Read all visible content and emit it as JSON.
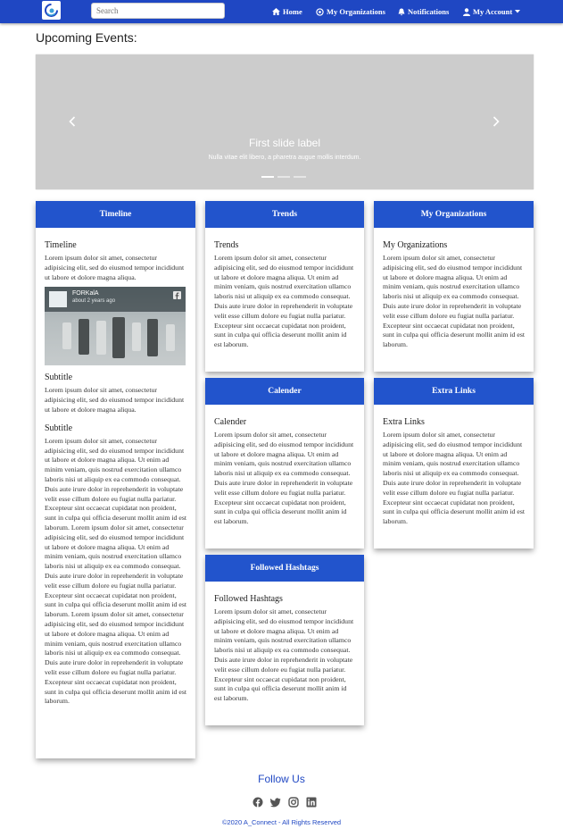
{
  "nav": {
    "search_placeholder": "Search",
    "home": "Home",
    "organizations": "My Organizations",
    "notifications": "Notifications",
    "account": "My Account"
  },
  "events": {
    "title": "Upcoming Events:",
    "slide_label": "First slide label",
    "slide_text": "Nulla vitae elit libero, a pharetra augue mollis interdum."
  },
  "video": {
    "channel": "FORKalA",
    "time": "about 2 years ago"
  },
  "timeline": {
    "header": "Timeline",
    "title": "Timeline",
    "text": "Lorem ipsum dolor sit amet, consectetur adipisicing elit, sed do eiusmod tempor incididunt ut labore et dolore magna aliqua.",
    "subtitle1": "Subtitle",
    "text2": "Lorem ipsum dolor sit amet, consectetur adipisicing elit, sed do eiusmod tempor incididunt ut labore et dolore magna aliqua.",
    "subtitle2": "Subtitle",
    "long_text": "Lorem ipsum dolor sit amet, consectetur adipisicing elit, sed do eiusmod tempor incididunt ut labore et dolore magna aliqua. Ut enim ad minim veniam, quis nostrud exercitation ullamco laboris nisi ut aliquip ex ea commodo consequat. Duis aute irure dolor in reprehenderit in voluptate velit esse cillum dolore eu fugiat nulla pariatur. Excepteur sint occaecat cupidatat non proident, sunt in culpa qui officia deserunt mollit anim id est laborum. Lorem ipsum dolor sit amet, consectetur adipisicing elit, sed do eiusmod tempor incididunt ut labore et dolore magna aliqua. Ut enim ad minim veniam, quis nostrud exercitation ullamco laboris nisi ut aliquip ex ea commodo consequat. Duis aute irure dolor in reprehenderit in voluptate velit esse cillum dolore eu fugiat nulla pariatur. Excepteur sint occaecat cupidatat non proident, sunt in culpa qui officia deserunt mollit anim id est laborum. Lorem ipsum dolor sit amet, consectetur adipisicing elit, sed do eiusmod tempor incididunt ut labore et dolore magna aliqua. Ut enim ad minim veniam, quis nostrud exercitation ullamco laboris nisi ut aliquip ex ea commodo consequat. Duis aute irure dolor in reprehenderit in voluptate velit esse cillum dolore eu fugiat nulla pariatur. Excepteur sint occaecat cupidatat non proident, sunt in culpa qui officia deserunt mollit anim id est laborum."
  },
  "trends": {
    "header": "Trends",
    "title": "Trends",
    "text": "Lorem ipsum dolor sit amet, consectetur adipisicing elit, sed do eiusmod tempor incididunt ut labore et dolore magna aliqua. Ut enim ad minim veniam, quis nostrud exercitation ullamco laboris nisi ut aliquip ex ea commodo consequat. Duis aute irure dolor in reprehenderit in voluptate velit esse cillum dolore eu fugiat nulla pariatur. Excepteur sint occaecat cupidatat non proident, sunt in culpa qui officia deserunt mollit anim id est laborum."
  },
  "my_orgs": {
    "header": "My Organizations",
    "title": "My Organizations",
    "text": "Lorem ipsum dolor sit amet, consectetur adipisicing elit, sed do eiusmod tempor incididunt ut labore et dolore magna aliqua. Ut enim ad minim veniam, quis nostrud exercitation ullamco laboris nisi ut aliquip ex ea commodo consequat. Duis aute irure dolor in reprehenderit in voluptate velit esse cillum dolore eu fugiat nulla pariatur. Excepteur sint occaecat cupidatat non proident, sunt in culpa qui officia deserunt mollit anim id est laborum."
  },
  "calender": {
    "header": "Calender",
    "title": "Calender",
    "text": "Lorem ipsum dolor sit amet, consectetur adipisicing elit, sed do eiusmod tempor incididunt ut labore et dolore magna aliqua. Ut enim ad minim veniam, quis nostrud exercitation ullamco laboris nisi ut aliquip ex ea commodo consequat. Duis aute irure dolor in reprehenderit in voluptate velit esse cillum dolore eu fugiat nulla pariatur. Excepteur sint occaecat cupidatat non proident, sunt in culpa qui officia deserunt mollit anim id est laborum."
  },
  "extra_links": {
    "header": "Extra Links",
    "title": "Extra Links",
    "text": "Lorem ipsum dolor sit amet, consectetur adipisicing elit, sed do eiusmod tempor incididunt ut labore et dolore magna aliqua. Ut enim ad minim veniam, quis nostrud exercitation ullamco laboris nisi ut aliquip ex ea commodo consequat. Duis aute irure dolor in reprehenderit in voluptate velit esse cillum dolore eu fugiat nulla pariatur. Excepteur sint occaecat cupidatat non proident, sunt in culpa qui officia deserunt mollit anim id est laborum."
  },
  "hashtags": {
    "header": "Followed Hashtags",
    "title": "Followed Hashtags",
    "text": "Lorem ipsum dolor sit amet, consectetur adipisicing elit, sed do eiusmod tempor incididunt ut labore et dolore magna aliqua. Ut enim ad minim veniam, quis nostrud exercitation ullamco laboris nisi ut aliquip ex ea commodo consequat. Duis aute irure dolor in reprehenderit in voluptate velit esse cillum dolore eu fugiat nulla pariatur. Excepteur sint occaecat cupidatat non proident, sunt in culpa qui officia deserunt mollit anim id est laborum."
  },
  "footer": {
    "follow": "Follow Us",
    "copyright": "©2020 A_Connect - All Rights Reserved",
    "icons": [
      "facebook-icon",
      "twitter-icon",
      "instagram-icon",
      "linkedin-icon"
    ]
  },
  "colors": {
    "brand": "#1f47c3",
    "card_header": "#2254cc",
    "carousel_bg": "#cccccc"
  }
}
